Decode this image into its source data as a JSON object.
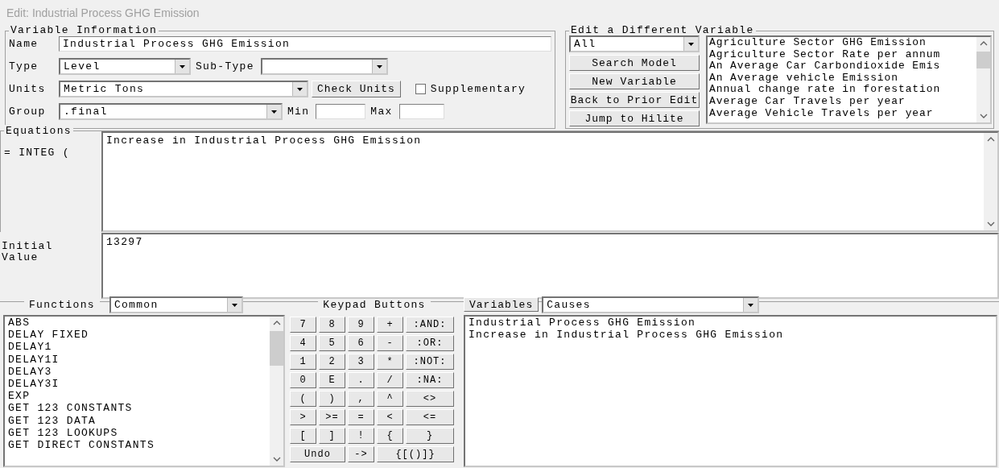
{
  "window": {
    "title": "Edit: Industrial Process GHG Emission"
  },
  "variable_information": {
    "title": "Variable Information",
    "name_label": "Name",
    "name": "Industrial Process GHG Emission",
    "type_label": "Type",
    "type": "Level",
    "subtype_label": "Sub-Type",
    "units_label": "Units",
    "units": "Metric Tons",
    "check_units_button": "Check Units",
    "supplementary": {
      "label": "Supplementary",
      "checked": false
    },
    "group_label": "Group",
    "group": ".final",
    "min_label": "Min",
    "max_label": "Max"
  },
  "edit_different_variable": {
    "title": "Edit a Different Variable",
    "filter": "All",
    "buttons": [
      "Search Model",
      "New Variable",
      "Back to Prior Edit",
      "Jump to Hilite"
    ],
    "variables": [
      "Agriculture Sector GHG Emission",
      "Agriculture Sector Rate per annum",
      "An Average Car Carbondioxide Emis",
      "An Average vehicle Emission",
      "Annual change rate in forestation",
      "Average Car Travels per year",
      "Average Vehicle Travels per year"
    ]
  },
  "equations": {
    "title": "Equations",
    "prefix": "= INTEG (",
    "equation": "Increase in Industrial Process GHG Emission"
  },
  "initial_value": {
    "label": "Initial Value",
    "value": "13297"
  },
  "functions": {
    "title": "Functions",
    "category": "Common",
    "items": [
      "ABS",
      "DELAY FIXED",
      "DELAY1",
      "DELAY1I",
      "DELAY3",
      "DELAY3I",
      "EXP",
      "GET 123 CONSTANTS",
      "GET 123 DATA",
      "GET 123 LOOKUPS",
      "GET DIRECT CONSTANTS"
    ]
  },
  "keypad": {
    "title": "Keypad Buttons",
    "keys": [
      {
        "label": "7",
        "kind": "key"
      },
      {
        "label": "8",
        "kind": "key"
      },
      {
        "label": "9",
        "kind": "key"
      },
      {
        "label": "+",
        "kind": "key"
      },
      {
        "label": ":AND:",
        "kind": "wide"
      },
      {
        "label": "4",
        "kind": "key"
      },
      {
        "label": "5",
        "kind": "key"
      },
      {
        "label": "6",
        "kind": "key"
      },
      {
        "label": "-",
        "kind": "key"
      },
      {
        "label": ":OR:",
        "kind": "wide"
      },
      {
        "label": "1",
        "kind": "key"
      },
      {
        "label": "2",
        "kind": "key"
      },
      {
        "label": "3",
        "kind": "key"
      },
      {
        "label": "*",
        "kind": "key"
      },
      {
        "label": ":NOT:",
        "kind": "wide"
      },
      {
        "label": "0",
        "kind": "key"
      },
      {
        "label": "E",
        "kind": "key"
      },
      {
        "label": ".",
        "kind": "key"
      },
      {
        "label": "/",
        "kind": "key"
      },
      {
        "label": ":NA:",
        "kind": "wide"
      },
      {
        "label": "(",
        "kind": "key"
      },
      {
        "label": ")",
        "kind": "key"
      },
      {
        "label": ",",
        "kind": "key"
      },
      {
        "label": "^",
        "kind": "key"
      },
      {
        "label": "<>",
        "kind": "key"
      },
      {
        "label": ">",
        "kind": "key"
      },
      {
        "label": ">=",
        "kind": "key"
      },
      {
        "label": "=",
        "kind": "key"
      },
      {
        "label": "<",
        "kind": "key"
      },
      {
        "label": "<=",
        "kind": "key"
      },
      {
        "label": "[",
        "kind": "key"
      },
      {
        "label": "]",
        "kind": "key"
      },
      {
        "label": "!",
        "kind": "key"
      },
      {
        "label": "{",
        "kind": "key"
      },
      {
        "label": "}",
        "kind": "key"
      },
      {
        "label": "Undo",
        "kind": "double"
      },
      {
        "label": "->",
        "kind": "key"
      },
      {
        "label": "{[()]}",
        "kind": "double"
      }
    ]
  },
  "variables_panel": {
    "button": "Variables",
    "mode": "Causes",
    "items": [
      "Industrial Process GHG Emission",
      "Increase in Industrial Process GHG Emission"
    ]
  }
}
